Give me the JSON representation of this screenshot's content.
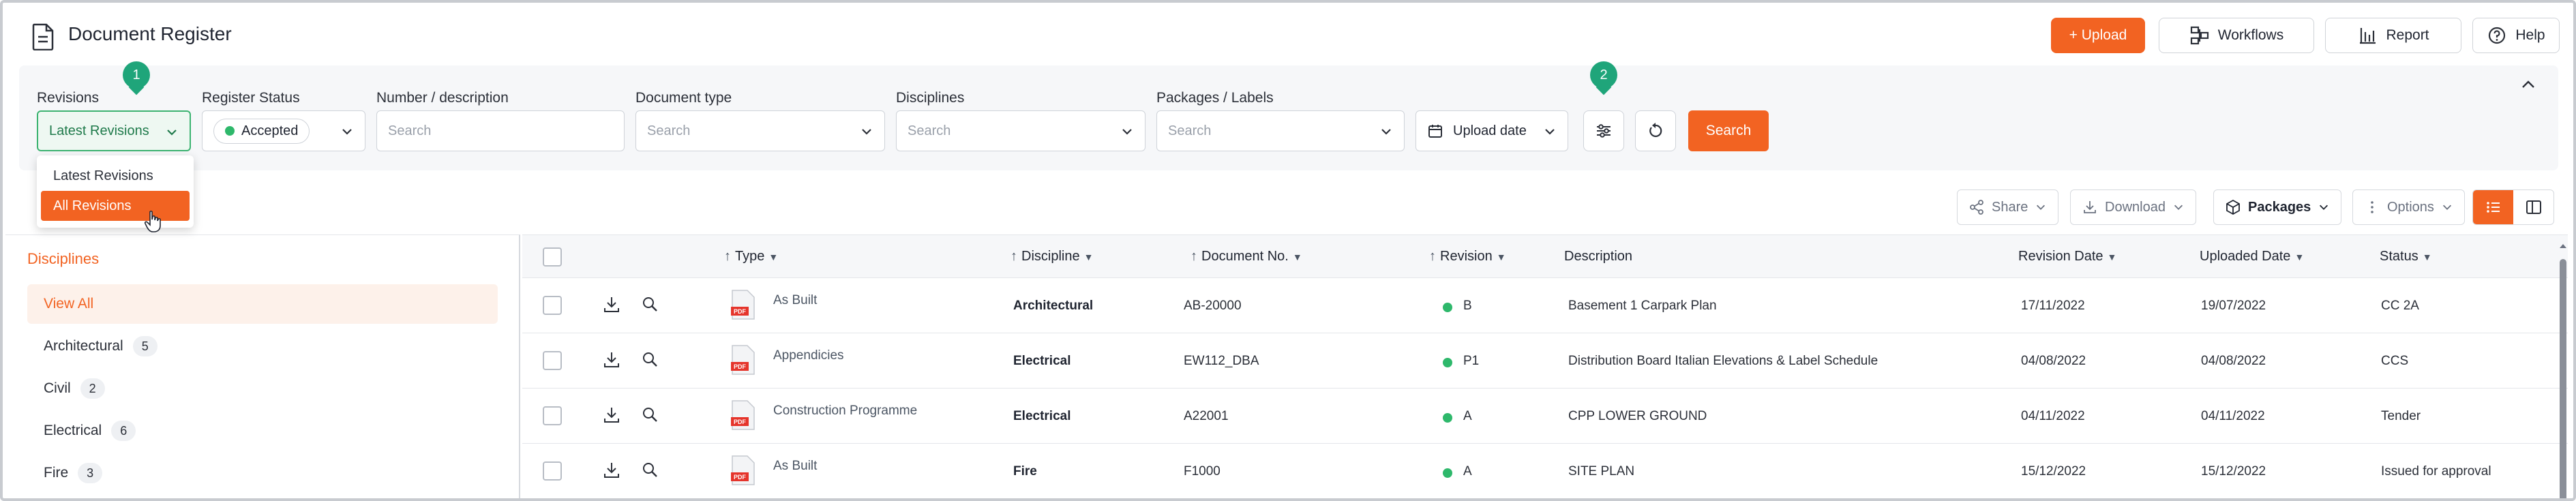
{
  "app": {
    "title": "Document Register"
  },
  "header": {
    "upload_label": "+ Upload",
    "workflows_label": "Workflows",
    "report_label": "Report",
    "help_label": "Help",
    "accent_color": "#f26322"
  },
  "filters": {
    "revisions": {
      "label": "Revisions",
      "value": "Latest Revisions"
    },
    "register_status": {
      "label": "Register Status",
      "value": "Accepted"
    },
    "number_description": {
      "label": "Number / description",
      "placeholder": "Search"
    },
    "document_type": {
      "label": "Document type",
      "placeholder": "Search"
    },
    "disciplines": {
      "label": "Disciplines",
      "placeholder": "Search"
    },
    "packages_labels": {
      "label": "Packages / Labels",
      "placeholder": "Search"
    },
    "upload_date": {
      "value": "Upload date"
    },
    "search_label": "Search"
  },
  "markers": {
    "one": "1",
    "two": "2"
  },
  "revisions_dropdown": {
    "options": [
      "Latest Revisions",
      "All Revisions"
    ],
    "selected": "All Revisions"
  },
  "toolbar": {
    "share_label": "Share",
    "download_label": "Download",
    "packages_label": "Packages",
    "options_label": "Options"
  },
  "sidebar": {
    "title": "Disciplines",
    "items": [
      {
        "label": "View All",
        "count": ""
      },
      {
        "label": "Architectural",
        "count": "5"
      },
      {
        "label": "Civil",
        "count": "2"
      },
      {
        "label": "Electrical",
        "count": "6"
      },
      {
        "label": "Fire",
        "count": "3"
      }
    ]
  },
  "table": {
    "columns": {
      "type": "Type",
      "discipline": "Discipline",
      "document_no": "Document No.",
      "revision": "Revision",
      "description": "Description",
      "revision_date": "Revision Date",
      "uploaded_date": "Uploaded Date",
      "status": "Status"
    },
    "rows": [
      {
        "type": "As Built",
        "discipline": "Architectural",
        "document_no": "AB-20000",
        "revision": "B",
        "description": "Basement 1 Carpark Plan",
        "revision_date": "17/11/2022",
        "uploaded_date": "19/07/2022",
        "status": "CC 2A"
      },
      {
        "type": "Appendicies",
        "discipline": "Electrical",
        "document_no": "EW112_DBA",
        "revision": "P1",
        "description": "Distribution Board Italian Elevations & Label Schedule",
        "revision_date": "04/08/2022",
        "uploaded_date": "04/08/2022",
        "status": "CCS"
      },
      {
        "type": "Construction Programme",
        "discipline": "Electrical",
        "document_no": "A22001",
        "revision": "A",
        "description": "CPP LOWER GROUND",
        "revision_date": "04/11/2022",
        "uploaded_date": "04/11/2022",
        "status": "Tender"
      },
      {
        "type": "As Built",
        "discipline": "Fire",
        "document_no": "F1000",
        "revision": "A",
        "description": "SITE PLAN",
        "revision_date": "15/12/2022",
        "uploaded_date": "15/12/2022",
        "status": "Issued for approval"
      }
    ]
  }
}
